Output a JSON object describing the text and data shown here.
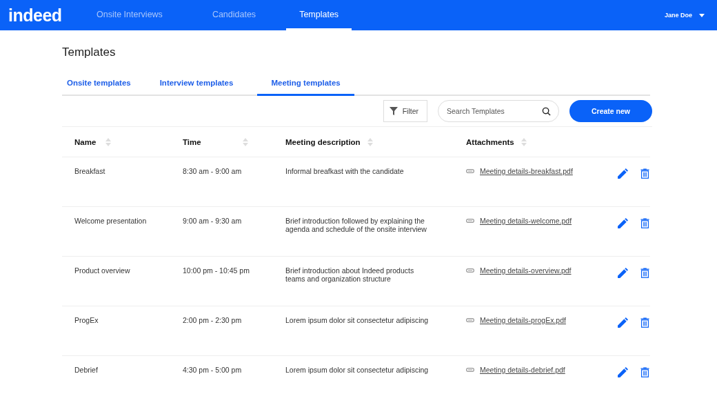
{
  "header": {
    "logo": "indeed",
    "nav": [
      {
        "label": "Onsite Interviews",
        "selected": false
      },
      {
        "label": "Candidates",
        "selected": false
      },
      {
        "label": "Templates",
        "selected": true
      }
    ],
    "user": "Jane Doe"
  },
  "page_title": "Templates",
  "tabs": [
    {
      "label": "Onsite templates",
      "selected": false
    },
    {
      "label": "Interview templates",
      "selected": false
    },
    {
      "label": "Meeting templates",
      "selected": true
    }
  ],
  "toolbar": {
    "filter": "Filter",
    "search": {
      "placeholder": "Search Templates"
    },
    "create": "Create new"
  },
  "table": {
    "columns": [
      "Name",
      "Time",
      "Meeting description",
      "Attachments"
    ],
    "rows": [
      {
        "name": "Breakfast",
        "time": "8:30 am - 9:00 am",
        "description": "Informal breafkast with the candidate",
        "attachment": "Meeting details-breakfast.pdf"
      },
      {
        "name": "Welcome presentation",
        "time": "9:00 am - 9:30 am",
        "description": "Brief introduction followed by explaining the agenda and schedule of the onsite interview",
        "attachment": "Meeting details-welcome.pdf"
      },
      {
        "name": "Product overview",
        "time": "10:00 pm - 10:45 pm",
        "description": "Brief introduction about Indeed products teams and organization structure",
        "attachment": "Meeting details-overview.pdf"
      },
      {
        "name": "ProgEx",
        "time": "2:00 pm - 2:30 pm",
        "description": "Lorem ipsum dolor sit consectetur adipiscing",
        "attachment": "Meeting details-progEx.pdf"
      },
      {
        "name": "Debrief",
        "time": "4:30 pm - 5:00 pm",
        "description": "Lorem ipsum dolor sit consectetur adipiscing",
        "attachment": "Meeting details-debrief.pdf"
      }
    ]
  }
}
